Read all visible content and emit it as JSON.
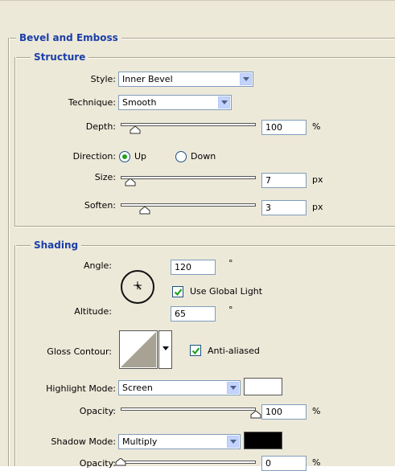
{
  "bevel_emboss": {
    "title": "Bevel and Emboss",
    "structure": {
      "title": "Structure",
      "style_label": "Style:",
      "style_value": "Inner Bevel",
      "technique_label": "Technique:",
      "technique_value": "Smooth",
      "depth_label": "Depth:",
      "depth_value": "100",
      "depth_unit": "%",
      "direction_label": "Direction:",
      "direction_up": "Up",
      "direction_down": "Down",
      "direction_selected": "Up",
      "size_label": "Size:",
      "size_value": "7",
      "size_unit": "px",
      "soften_label": "Soften:",
      "soften_value": "3",
      "soften_unit": "px"
    },
    "shading": {
      "title": "Shading",
      "angle_label": "Angle:",
      "angle_value": "120",
      "angle_unit": "°",
      "use_global_light_label": "Use Global Light",
      "use_global_light_checked": true,
      "altitude_label": "Altitude:",
      "altitude_value": "65",
      "altitude_unit": "°",
      "gloss_contour_label": "Gloss Contour:",
      "anti_aliased_label": "Anti-aliased",
      "anti_aliased_checked": true,
      "highlight_mode_label": "Highlight Mode:",
      "highlight_mode_value": "Screen",
      "highlight_color": "#ffffff",
      "highlight_opacity_label": "Opacity:",
      "highlight_opacity_value": "100",
      "highlight_opacity_unit": "%",
      "shadow_mode_label": "Shadow Mode:",
      "shadow_mode_value": "Multiply",
      "shadow_color": "#000000",
      "shadow_opacity_label": "Opacity:",
      "shadow_opacity_value": "0",
      "shadow_opacity_unit": "%"
    }
  }
}
